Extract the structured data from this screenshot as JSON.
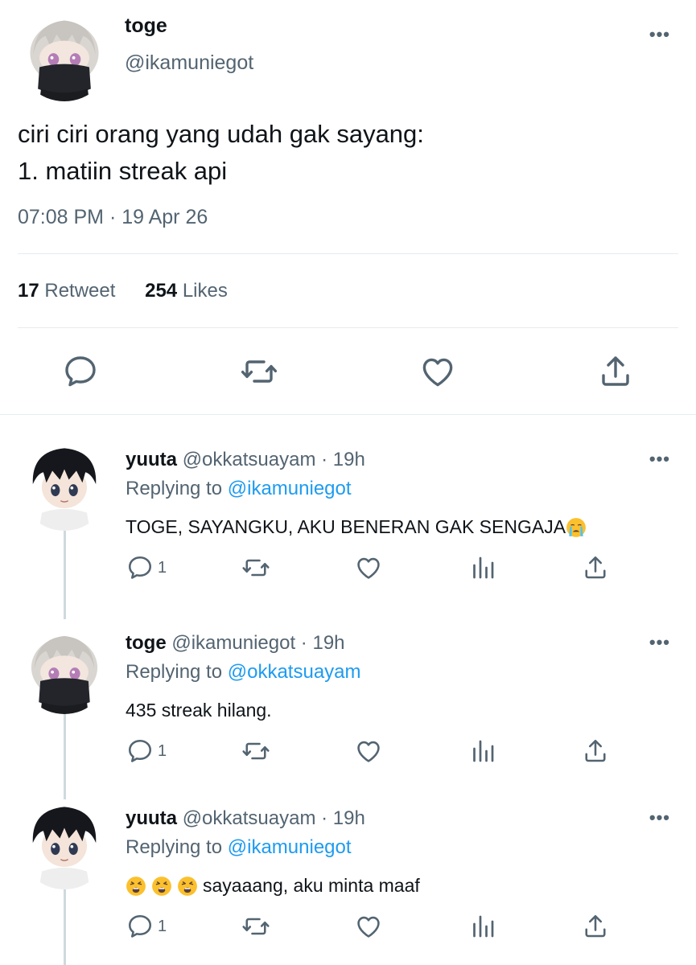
{
  "main_tweet": {
    "display_name": "toge",
    "handle": "@ikamuniegot",
    "more_label": "•••",
    "text": "ciri ciri orang yang udah gak sayang:\n1. matiin streak api",
    "timestamp": "07:08 PM · 19 Apr 26",
    "retweets": {
      "count": "17",
      "label": "Retweet"
    },
    "likes": {
      "count": "254",
      "label": "Likes"
    },
    "actions": [
      "reply-icon",
      "retweet-icon",
      "like-icon",
      "share-icon"
    ]
  },
  "replies": [
    {
      "display_name": "yuuta",
      "handle": "@okkatsuayam",
      "separator": "·",
      "age": "19h",
      "replying_label": "Replying to",
      "replying_to": "@ikamuniegot",
      "text": "TOGE, SAYANGKU, AKU BENERAN GAK SENGAJA",
      "emoji_after": "loudly-crying-face",
      "reply_count": "1",
      "more_label": "•••"
    },
    {
      "display_name": "toge",
      "handle": "@ikamuniegot",
      "separator": "·",
      "age": "19h",
      "replying_label": "Replying to",
      "replying_to": "@okkatsuayam",
      "text": "435 streak hilang.",
      "reply_count": "1",
      "more_label": "•••"
    },
    {
      "display_name": "yuuta",
      "handle": "@okkatsuayam",
      "separator": "·",
      "age": "19h",
      "replying_label": "Replying to",
      "replying_to": "@ikamuniegot",
      "emoji_before": [
        "weary-face",
        "weary-face",
        "weary-face"
      ],
      "text": "sayaaang, aku minta maaf",
      "reply_count": "1",
      "more_label": "•••"
    }
  ],
  "colors": {
    "text_primary": "#0f1419",
    "text_secondary": "#536471",
    "link": "#1d9bf0",
    "divider": "#e6ecf0",
    "thread_line": "#cfd9de"
  }
}
